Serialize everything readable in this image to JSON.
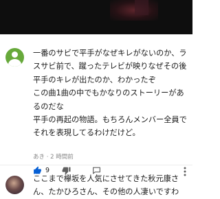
{
  "comments": [
    {
      "text": "一番のサビで平手がなぜキレがないのか、ラスサビ前で、蹴ったテレビが映りなぜその後平手のキレが出たのか、わかったぞ\nこの曲1曲の中でもかなりのストーリーがあるのだな\n平手の再起の物語。もちろんメンバー全員でそれを表現してるわけだけど。",
      "author": "あき",
      "time": "2 時間前",
      "likes": "9",
      "avatar_color": "#67a93b"
    },
    {
      "text": "ここまで欅坂を人気にさせてきた秋元康さん、たかひろさん、その他の人凄いですわ"
    }
  ],
  "icons": {
    "like": "thumbs-up-icon",
    "dislike": "thumbs-down-icon",
    "reply": "reply-icon",
    "more": "more-vertical-icon"
  },
  "colors": {
    "like_active": "#065fd4",
    "icon_grey": "#606060"
  }
}
